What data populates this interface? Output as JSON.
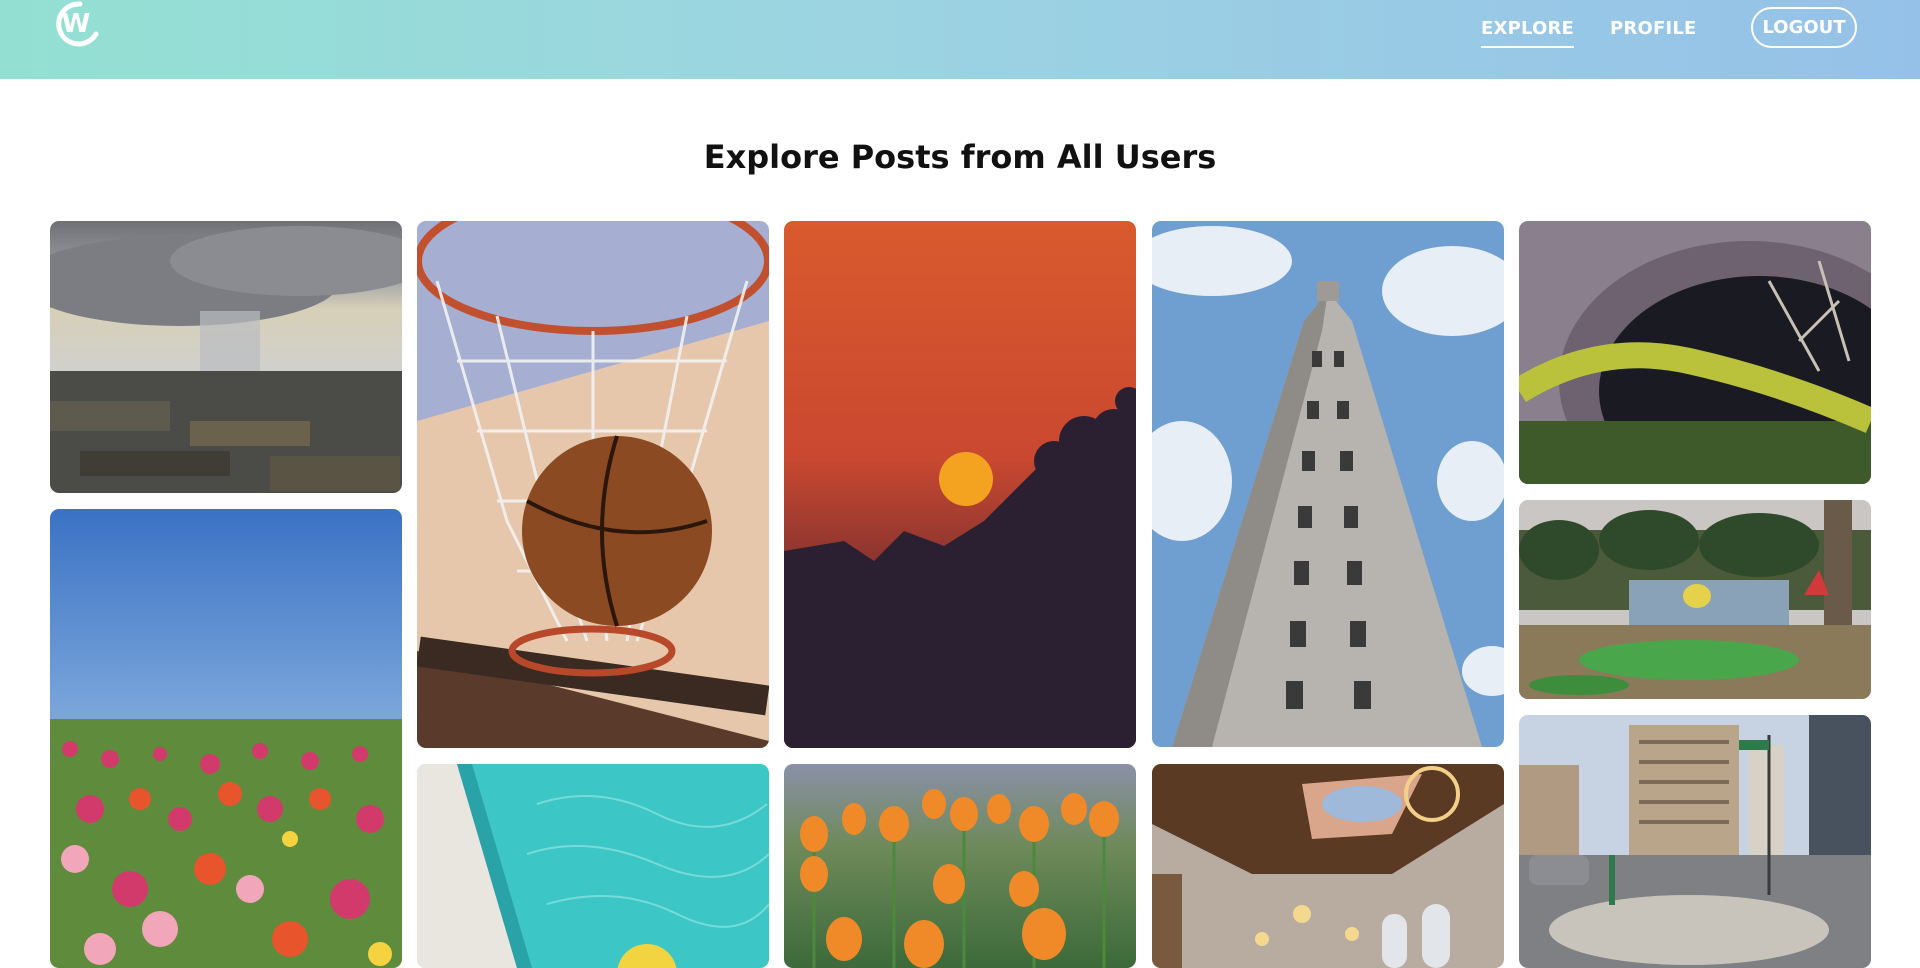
{
  "header": {
    "logo_letter": "W",
    "nav": {
      "explore": "EXPLORE",
      "profile": "PROFILE"
    },
    "logout": "LOGOUT"
  },
  "main": {
    "title": "Explore Posts from All Users"
  },
  "posts": [
    {
      "subject": "storm-over-farmland"
    },
    {
      "subject": "poppy-field-blue-sky"
    },
    {
      "subject": "basketball-in-hoop"
    },
    {
      "subject": "swimming-pool-water"
    },
    {
      "subject": "sunset-silhouette"
    },
    {
      "subject": "orange-poppies"
    },
    {
      "subject": "flatiron-building"
    },
    {
      "subject": "ornate-library-ceiling"
    },
    {
      "subject": "mossy-tunnel"
    },
    {
      "subject": "abandoned-mini-golf"
    },
    {
      "subject": "city-street-corner"
    }
  ],
  "colors": {
    "header_left": "#93e0d2",
    "header_right": "#95c1e8",
    "nav_text": "#ffffff"
  }
}
